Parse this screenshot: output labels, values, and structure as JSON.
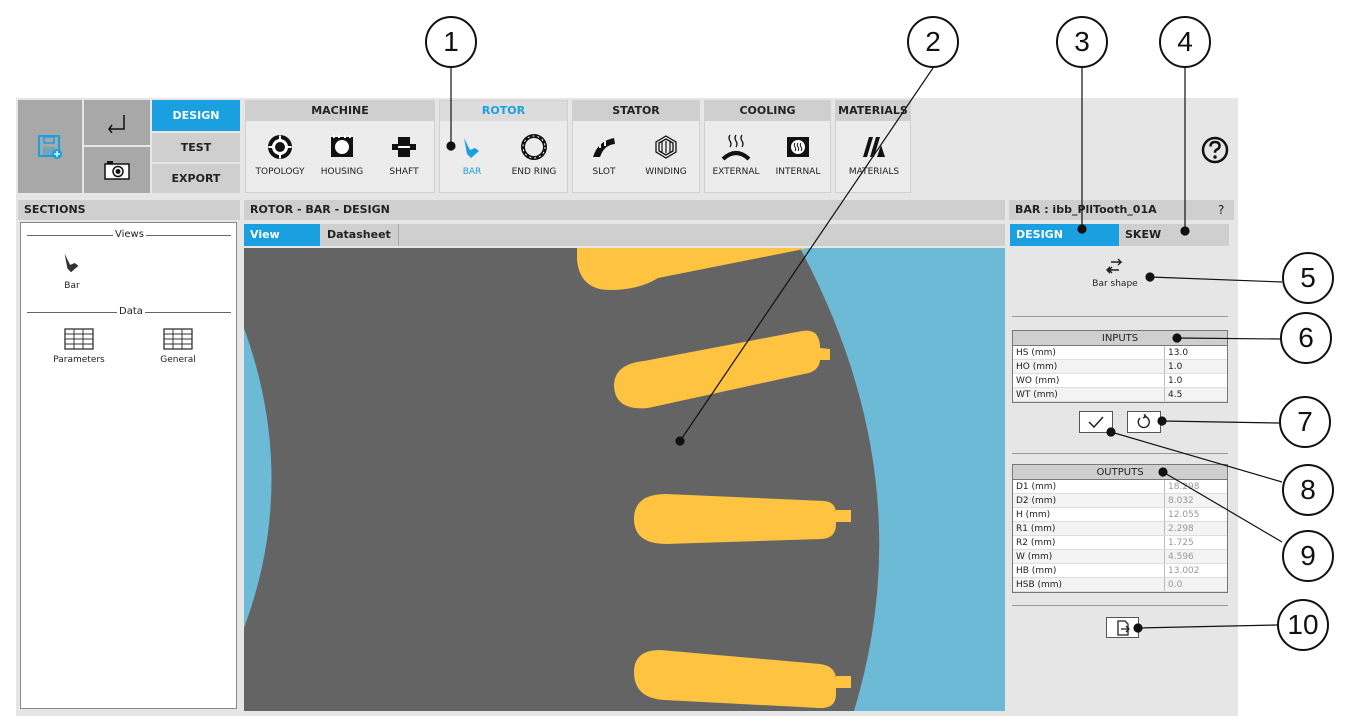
{
  "ribbon": {
    "modes": [
      "DESIGN",
      "TEST",
      "EXPORT"
    ],
    "groups": {
      "machine": {
        "title": "MACHINE",
        "tools": [
          "TOPOLOGY",
          "HOUSING",
          "SHAFT"
        ]
      },
      "rotor": {
        "title": "ROTOR",
        "tools": [
          "BAR",
          "END RING"
        ]
      },
      "stator": {
        "title": "STATOR",
        "tools": [
          "SLOT",
          "WINDING"
        ]
      },
      "cooling": {
        "title": "COOLING",
        "tools": [
          "EXTERNAL",
          "INTERNAL"
        ]
      },
      "materials": {
        "title": "MATERIALS",
        "tools": [
          "MATERIALS"
        ]
      }
    },
    "help_icon": "question-circle-icon"
  },
  "sections": {
    "title": "SECTIONS",
    "views_label": "Views",
    "views": [
      "Bar"
    ],
    "data_label": "Data",
    "data": [
      "Parameters",
      "General"
    ]
  },
  "center": {
    "title": "ROTOR - BAR - DESIGN",
    "tabs": [
      "View",
      "Datasheet"
    ]
  },
  "right": {
    "title": "BAR : ibb_PllTooth_01A",
    "help": "?",
    "tabs": [
      "DESIGN",
      "SKEW"
    ],
    "bar_shape_label": "Bar shape",
    "inputs": {
      "title": "INPUTS",
      "rows": [
        {
          "k": "HS (mm)",
          "v": "13.0"
        },
        {
          "k": "HO (mm)",
          "v": "1.0"
        },
        {
          "k": "WO (mm)",
          "v": "1.0"
        },
        {
          "k": "WT (mm)",
          "v": "4.5"
        }
      ]
    },
    "outputs": {
      "title": "OUTPUTS",
      "rows": [
        {
          "k": "D1 (mm)",
          "v": "18.298"
        },
        {
          "k": "D2 (mm)",
          "v": "8.032"
        },
        {
          "k": "H (mm)",
          "v": "12.055"
        },
        {
          "k": "R1 (mm)",
          "v": "2.298"
        },
        {
          "k": "R2 (mm)",
          "v": "1.725"
        },
        {
          "k": "W (mm)",
          "v": "4.596"
        },
        {
          "k": "HB (mm)",
          "v": "13.002"
        },
        {
          "k": "HSB (mm)",
          "v": "0.0"
        }
      ]
    }
  },
  "callouts": [
    "1",
    "2",
    "3",
    "4",
    "5",
    "6",
    "7",
    "8",
    "9",
    "10"
  ],
  "colors": {
    "accent": "#1a9fe0",
    "bar": "#fec441",
    "iron": "#646464",
    "air": "#6cbad6"
  }
}
